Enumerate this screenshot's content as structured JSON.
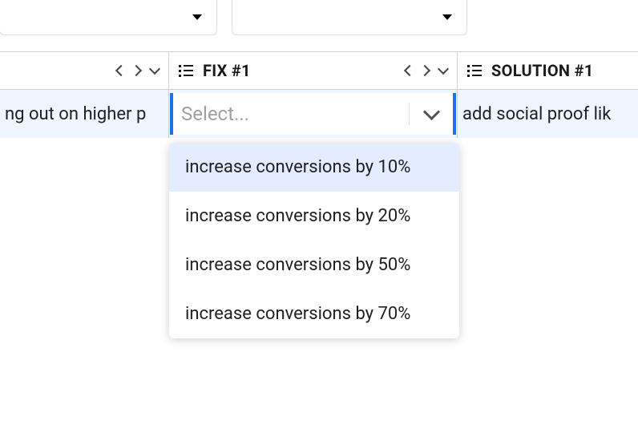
{
  "columns": {
    "col0": {
      "cell_text": "ng out on higher p"
    },
    "col1": {
      "label": "FIX #1"
    },
    "col2": {
      "label": "SOLUTION #1",
      "cell_text": "add social proof lik"
    }
  },
  "select": {
    "placeholder": "Select...",
    "options": [
      "increase conversions by 10%",
      "increase conversions by 20%",
      "increase conversions by 50%",
      "increase conversions by 70%"
    ],
    "highlighted_index": 0
  }
}
